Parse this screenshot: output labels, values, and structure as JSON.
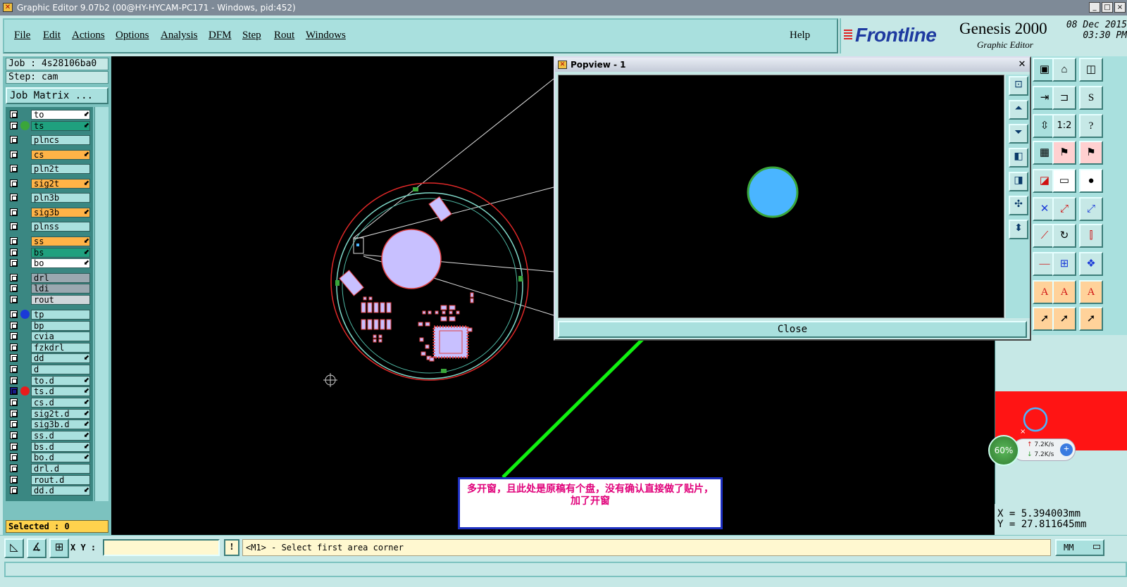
{
  "window": {
    "title": "Graphic Editor 9.07b2 (00@HY-HYCAM-PC171 - Windows, pid:452)",
    "controls": [
      "_",
      "□",
      "×"
    ]
  },
  "menu": {
    "items": [
      "File",
      "Edit",
      "Actions",
      "Options",
      "Analysis",
      "DFM",
      "Step",
      "Rout",
      "Windows"
    ],
    "help": "Help"
  },
  "brand": {
    "logo": "Frontline",
    "product": "Genesis 2000",
    "subtitle": "Graphic Editor",
    "date": "08 Dec 2015",
    "time": "03:30 PM"
  },
  "job": {
    "job_label": "Job : 4s28106ba0",
    "step_label": "Step: cam",
    "matrix_button": "Job Matrix ..."
  },
  "layers": [
    {
      "name": "to",
      "color": "#ffffff",
      "dot": "",
      "arrow": true
    },
    {
      "name": "ts",
      "color": "#1fa07e",
      "dot": "#3aa63a",
      "arrow": true
    },
    {
      "name": "plncs",
      "color": "#a9e0de",
      "dot": "",
      "arrow": false
    },
    {
      "name": "cs",
      "color": "#ffb347",
      "dot": "",
      "arrow": true
    },
    {
      "name": "pln2t",
      "color": "#a9e0de",
      "dot": "",
      "arrow": false
    },
    {
      "name": "sig2t",
      "color": "#ffb347",
      "dot": "",
      "arrow": true
    },
    {
      "name": "pln3b",
      "color": "#a9e0de",
      "dot": "",
      "arrow": false
    },
    {
      "name": "sig3b",
      "color": "#ffb347",
      "dot": "",
      "arrow": true
    },
    {
      "name": "plnss",
      "color": "#a9e0de",
      "dot": "",
      "arrow": false
    },
    {
      "name": "ss",
      "color": "#ffb347",
      "dot": "",
      "arrow": true
    },
    {
      "name": "bs",
      "color": "#1fa07e",
      "dot": "",
      "arrow": true
    },
    {
      "name": "bo",
      "color": "#ffffff",
      "dot": "",
      "arrow": true
    },
    {
      "name": "drl",
      "color": "#9aa8b0",
      "dot": "",
      "arrow": false
    },
    {
      "name": "ldi",
      "color": "#9aa8b0",
      "dot": "",
      "arrow": false
    },
    {
      "name": "rout",
      "color": "#cfd6da",
      "dot": "",
      "arrow": false
    },
    {
      "name": "tp",
      "color": "#a9e0de",
      "dot": "#1a3ad8",
      "arrow": false
    },
    {
      "name": "bp",
      "color": "#a9e0de",
      "dot": "",
      "arrow": false
    },
    {
      "name": "cvia",
      "color": "#a9e0de",
      "dot": "",
      "arrow": false
    },
    {
      "name": "fzkdrl",
      "color": "#a9e0de",
      "dot": "",
      "arrow": false
    },
    {
      "name": "dd",
      "color": "#a9e0de",
      "dot": "",
      "arrow": true
    },
    {
      "name": "d",
      "color": "#a9e0de",
      "dot": "",
      "arrow": false
    },
    {
      "name": "to.d",
      "color": "#a9e0de",
      "dot": "",
      "arrow": true
    },
    {
      "name": "ts.d",
      "color": "#a9e0de",
      "dot": "#e81c1c",
      "arrow": true
    },
    {
      "name": "cs.d",
      "color": "#a9e0de",
      "dot": "",
      "arrow": true
    },
    {
      "name": "sig2t.d",
      "color": "#a9e0de",
      "dot": "",
      "arrow": true
    },
    {
      "name": "sig3b.d",
      "color": "#a9e0de",
      "dot": "",
      "arrow": true
    },
    {
      "name": "ss.d",
      "color": "#a9e0de",
      "dot": "",
      "arrow": true
    },
    {
      "name": "bs.d",
      "color": "#a9e0de",
      "dot": "",
      "arrow": true
    },
    {
      "name": "bo.d",
      "color": "#a9e0de",
      "dot": "",
      "arrow": true
    },
    {
      "name": "drl.d",
      "color": "#a9e0de",
      "dot": "",
      "arrow": false
    },
    {
      "name": "rout.d",
      "color": "#a9e0de",
      "dot": "",
      "arrow": false
    },
    {
      "name": "dd.d",
      "color": "#a9e0de",
      "dot": "",
      "arrow": true
    }
  ],
  "selected": "Selected : 0",
  "popview": {
    "title": "Popview - 1",
    "close_label": "Close"
  },
  "annotation": "多开窗，且此处是原稿有个盘，没有确认直接做了贴片，加了开窗",
  "network": {
    "percent": "60%",
    "up": "7.2K/s",
    "down": "7.2K/s"
  },
  "coords": {
    "x": "X =  5.394003mm",
    "y": "Y = 27.811645mm"
  },
  "status": {
    "xy_label": "X Y :",
    "xy_value": "",
    "message": "<M1> - Select first area corner",
    "units": "MM"
  },
  "tools": {
    "ratio_label": "1:2"
  },
  "colors": {
    "panel": "#a9e0de",
    "canvas": "#000000",
    "pad_blue": "#4ab5ff",
    "arrow_green": "#10f010",
    "annotation_text": "#e0007a"
  }
}
